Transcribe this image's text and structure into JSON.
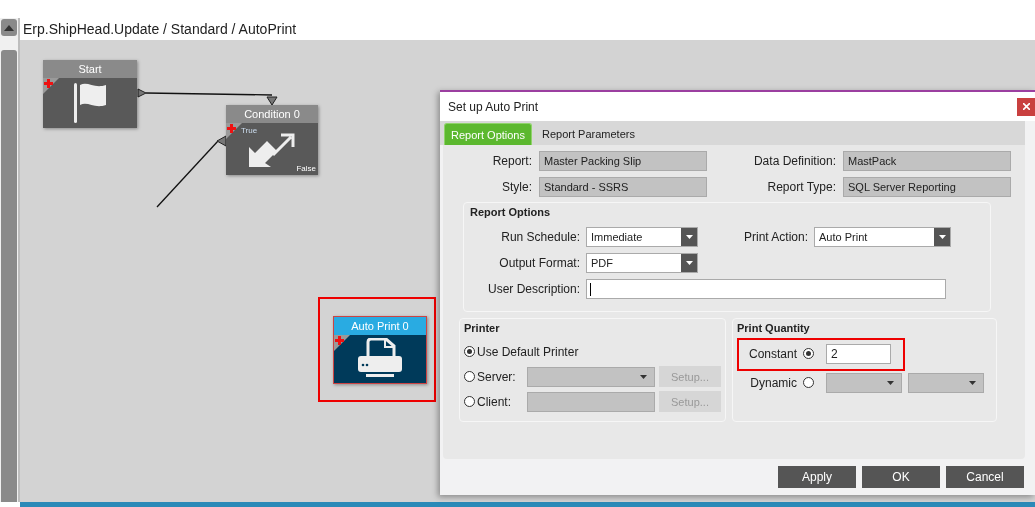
{
  "breadcrumb": "Erp.ShipHead.Update / Standard / AutoPrint",
  "nodes": [
    {
      "kind": "start",
      "title": "Start",
      "highlighted": false
    },
    {
      "kind": "condition",
      "title": "Condition 0",
      "true_label": "True",
      "false_label": "False",
      "highlighted": false
    },
    {
      "kind": "print",
      "title": "Auto Print 0",
      "highlighted": true
    }
  ],
  "dialog": {
    "title": "Set up Auto Print",
    "tabs": [
      {
        "label": "Report Options",
        "selected": true
      },
      {
        "label": "Report Parameters",
        "selected": false
      }
    ],
    "info_fields": [
      {
        "label": "Report:",
        "value": "Master Packing Slip"
      },
      {
        "label": "Data Definition:",
        "value": "MastPack"
      },
      {
        "label": "Style:",
        "value": "Standard - SSRS"
      },
      {
        "label": "Report Type:",
        "value": "SQL Server Reporting"
      }
    ],
    "report_options": {
      "title": "Report Options",
      "rows": [
        [
          {
            "kind": "dropdown",
            "label": "Run Schedule:",
            "value": "Immediate"
          },
          {
            "kind": "dropdown",
            "label": "Print Action:",
            "value": "Auto Print"
          }
        ],
        [
          {
            "kind": "dropdown",
            "label": "Output Format:",
            "value": "PDF"
          }
        ],
        [
          {
            "kind": "text",
            "label": "User Description:"
          }
        ]
      ]
    },
    "printer": {
      "title": "Printer",
      "options": [
        {
          "kind": "plain",
          "label": "Use Default Printer",
          "selected": true
        },
        {
          "kind": "dropdown",
          "label": "Server:",
          "selected": false,
          "button": "Setup..."
        },
        {
          "kind": "text",
          "label": "Client:",
          "selected": false,
          "button": "Setup..."
        }
      ]
    },
    "print_quantity": {
      "title": "Print Quantity",
      "options": [
        {
          "kind": "value",
          "label": "Constant",
          "selected": true,
          "value": "2",
          "highlighted": true
        },
        {
          "kind": "dropdowns",
          "label": "Dynamic",
          "selected": false,
          "highlighted": false
        }
      ]
    },
    "buttons": [
      "Apply",
      "OK",
      "Cancel"
    ]
  }
}
